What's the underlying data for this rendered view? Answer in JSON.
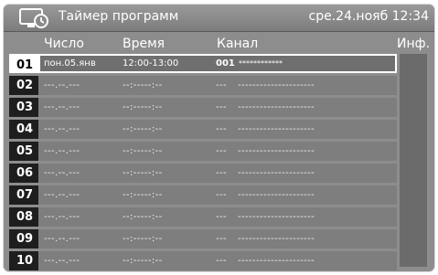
{
  "header": {
    "title": "Таймер программ",
    "clock": "сре.24.нояб 12:34"
  },
  "columns": {
    "date": "Число",
    "time": "Время",
    "channel": "Канал",
    "info": "Инф."
  },
  "rows": [
    {
      "num": "01",
      "date": "пон.05.янв",
      "time": "12:00-13:00",
      "channel_num": "001",
      "channel_name": "************",
      "selected": true
    },
    {
      "num": "02",
      "date": "---.--.---",
      "time": "--:-----:--",
      "channel_num": "---",
      "channel_name": "---------------------",
      "selected": false
    },
    {
      "num": "03",
      "date": "---.--.---",
      "time": "--:-----:--",
      "channel_num": "---",
      "channel_name": "---------------------",
      "selected": false
    },
    {
      "num": "04",
      "date": "---.--.---",
      "time": "--:-----:--",
      "channel_num": "---",
      "channel_name": "---------------------",
      "selected": false
    },
    {
      "num": "05",
      "date": "---.--.---",
      "time": "--:-----:--",
      "channel_num": "---",
      "channel_name": "---------------------",
      "selected": false
    },
    {
      "num": "06",
      "date": "---.--.---",
      "time": "--:-----:--",
      "channel_num": "---",
      "channel_name": "---------------------",
      "selected": false
    },
    {
      "num": "07",
      "date": "---.--.---",
      "time": "--:-----:--",
      "channel_num": "---",
      "channel_name": "---------------------",
      "selected": false
    },
    {
      "num": "08",
      "date": "---.--.---",
      "time": "--:-----:--",
      "channel_num": "---",
      "channel_name": "---------------------",
      "selected": false
    },
    {
      "num": "09",
      "date": "---.--.---",
      "time": "--:-----:--",
      "channel_num": "---",
      "channel_name": "---------------------",
      "selected": false
    },
    {
      "num": "10",
      "date": "---.--.---",
      "time": "--:-----:--",
      "channel_num": "---",
      "channel_name": "---------------------",
      "selected": false
    }
  ],
  "icons": {
    "title_icon": "tv-timer-icon"
  }
}
